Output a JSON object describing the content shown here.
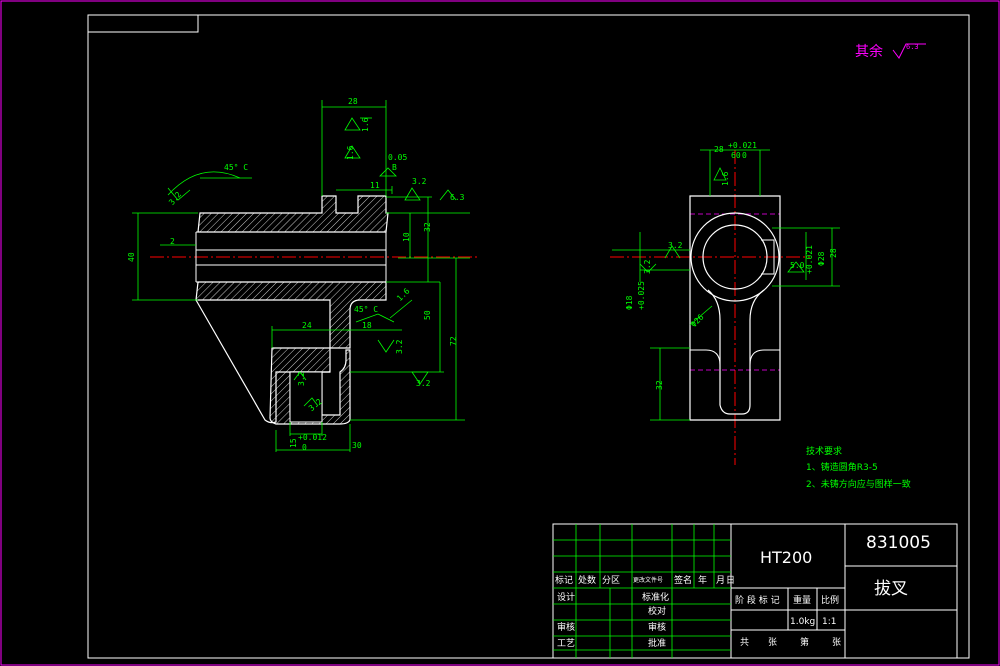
{
  "colors": {
    "background": "#000000",
    "frame": "#ffffff",
    "outline": "#ffffff",
    "dimension": "#00ff00",
    "center_line": "#ff0000",
    "hatch": "#ffffff",
    "highlight": "#ff00ff",
    "text": "#ffffff"
  },
  "roughness_note": {
    "label": "其余",
    "value": "6.3"
  },
  "left_view": {
    "dims": {
      "top_width": "28",
      "r16_a": "1.6",
      "r16_b": "1.6",
      "tol_005": "0.05",
      "tol_005_ref": "B",
      "slot_width": "11",
      "r32_top": "3.2",
      "r63": "6.3",
      "angle_45": "45° C",
      "r32_left": "3.2",
      "left_height": "40",
      "small_2": "2",
      "right_32": "32",
      "right_10": "10",
      "r16_right": "1.6",
      "right_50": "50",
      "right_72": "72",
      "angle_bottom": "45° C",
      "dim_24": "24",
      "dim_18": "18",
      "r32_mid": "3.2",
      "r32_bottom": "3.2",
      "r32_slot": "3.2",
      "r32_slot2": "3.2",
      "slot_dim": "15",
      "slot_tol": "+0.012",
      "slot_tol_zero": "0",
      "bottom_30": "30"
    }
  },
  "right_view": {
    "dims": {
      "top_dim": "28",
      "top_tol": "+0.021",
      "top_tol_b": "0",
      "top_60": "60",
      "r16": "1.6",
      "r32_left": "3.2",
      "r32_left2": "3.2",
      "left_dim": "Φ18",
      "left_tol": "+0.025",
      "right_dim": "Φ28",
      "right_tol": "+0.021",
      "r50": "5.0",
      "right_28": "28",
      "diag": "Φ26",
      "bottom_dim": "32"
    }
  },
  "tech_requirements": {
    "title": "技术要求",
    "items": [
      "1、铸造圆角R3-5",
      "2、未铸方向应与图样一致"
    ]
  },
  "title_block": {
    "material": "HT200",
    "drawing_number": "831005",
    "part_name": "拔叉",
    "row_labels": [
      "标记",
      "处数",
      "分区",
      "更改文件号",
      "签名",
      "年",
      "月",
      "日"
    ],
    "design": "设计",
    "standardize": "标准化",
    "review": "审核",
    "craft": "工艺",
    "approve": "批准",
    "check_label": "校对",
    "audit": "审核",
    "stage_label": "阶 段 标 记",
    "weight_label": "重量",
    "scale_label": "比例",
    "weight_value": "1.0kg",
    "scale_value": "1:1",
    "sheets_total": "共",
    "sheets_unit": "张",
    "sheet_no": "第",
    "sheet_unit": "张"
  }
}
